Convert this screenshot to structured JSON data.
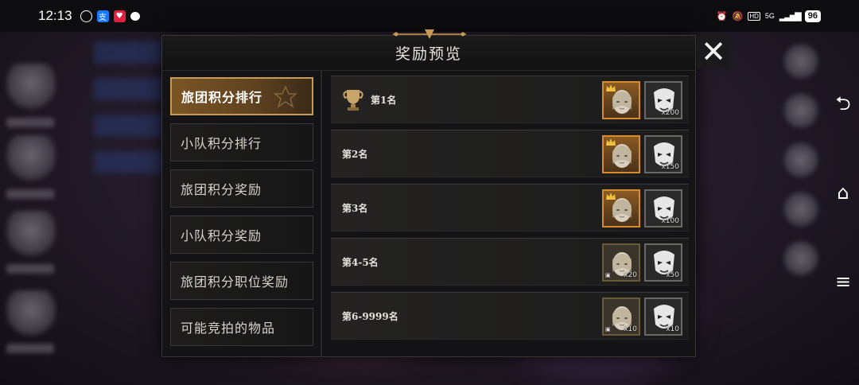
{
  "status_bar": {
    "time": "12:13",
    "battery": "96",
    "signal_label": "5G",
    "hd_label": "HD"
  },
  "dialog": {
    "title": "奖励预览",
    "close_label": "✕"
  },
  "tabs": [
    {
      "label": "旅团积分排行",
      "active": true
    },
    {
      "label": "小队积分排行",
      "active": false
    },
    {
      "label": "旅团积分奖励",
      "active": false
    },
    {
      "label": "小队积分奖励",
      "active": false
    },
    {
      "label": "旅团积分职位奖励",
      "active": false
    },
    {
      "label": "可能竞拍的物品",
      "active": false
    }
  ],
  "ranks": [
    {
      "label": "第1名",
      "trophy": true,
      "rewards": [
        {
          "kind": "gold-portrait",
          "qty": ""
        },
        {
          "kind": "mask",
          "qty": "x200"
        }
      ]
    },
    {
      "label": "第2名",
      "trophy": false,
      "rewards": [
        {
          "kind": "gold-portrait",
          "qty": ""
        },
        {
          "kind": "mask",
          "qty": "x150"
        }
      ]
    },
    {
      "label": "第3名",
      "trophy": false,
      "rewards": [
        {
          "kind": "gold-portrait",
          "qty": ""
        },
        {
          "kind": "mask",
          "qty": "x100"
        }
      ]
    },
    {
      "label": "第4-5名",
      "trophy": false,
      "rewards": [
        {
          "kind": "portrait",
          "qty": "x20"
        },
        {
          "kind": "mask",
          "qty": "x50"
        }
      ]
    },
    {
      "label": "第6-9999名",
      "trophy": false,
      "rewards": [
        {
          "kind": "portrait",
          "qty": "x10"
        },
        {
          "kind": "mask",
          "qty": "x10"
        }
      ]
    }
  ],
  "system_nav": {
    "back_icon": "back-icon",
    "home_icon": "home-icon",
    "menu_icon": "menu-icon"
  },
  "colors": {
    "accent_gold": "#c79a58",
    "active_tab": "#7a5525",
    "dialog_bg": "#141416"
  }
}
